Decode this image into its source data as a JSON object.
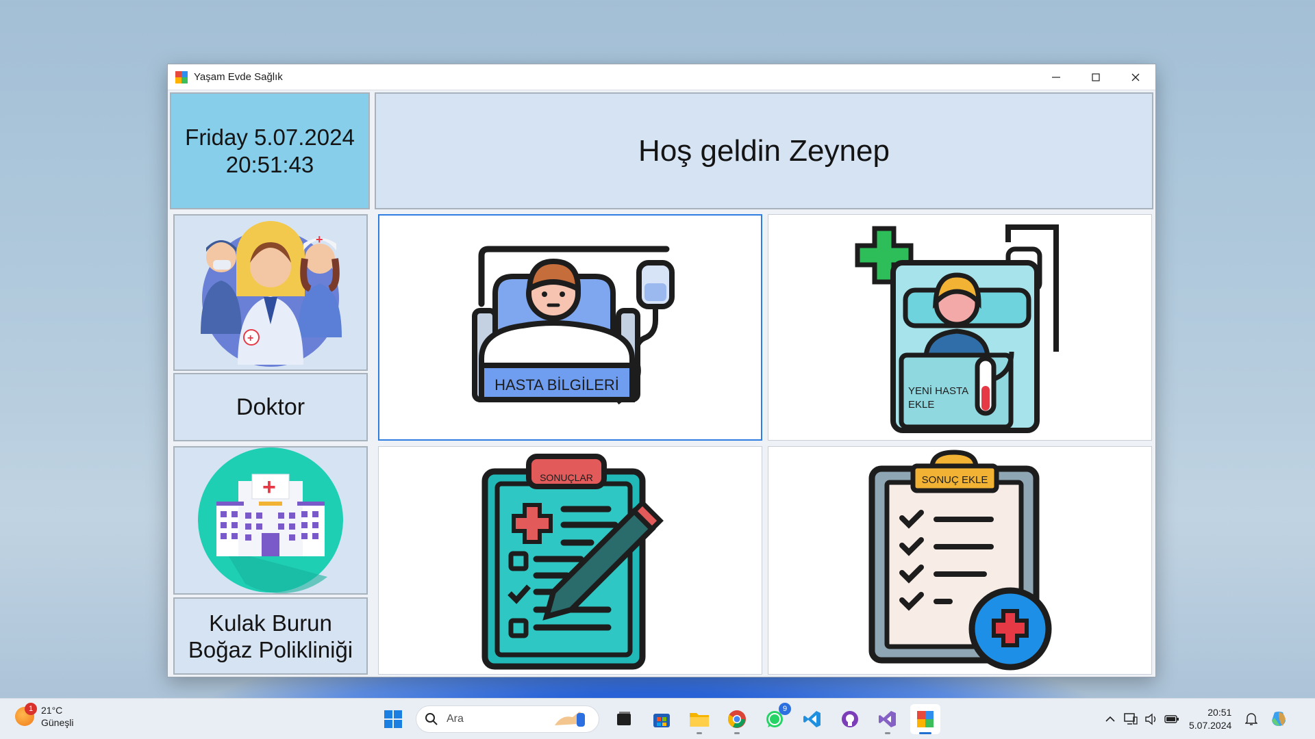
{
  "window": {
    "title": "Yaşam Evde Sağlık"
  },
  "header": {
    "date": "Friday 5.07.2024",
    "time": "20:51:43",
    "welcome": "Hoş geldin Zeynep"
  },
  "user": {
    "role": "Doktor",
    "clinic_line1": "Kulak Burun",
    "clinic_line2": "Boğaz Polikliniği"
  },
  "tiles": {
    "patient_info": "HASTA BİLGİLERİ",
    "new_patient_line1": "YENİ HASTA",
    "new_patient_line2": "EKLE",
    "results": "SONUÇLAR",
    "add_result": "SONUÇ EKLE"
  },
  "taskbar": {
    "temperature": "21°C",
    "weather": "Güneşli",
    "weather_badge": "1",
    "search_placeholder": "Ara",
    "whatsapp_badge": "9",
    "clock_time": "20:51",
    "clock_date": "5.07.2024"
  },
  "colors": {
    "clock_panel": "#87ceeb",
    "panel_bg": "#d6e3f3",
    "selection": "#2f7de1"
  }
}
